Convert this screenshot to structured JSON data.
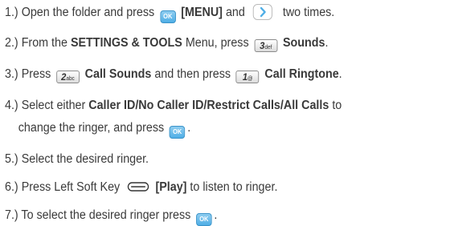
{
  "steps": [
    {
      "num": "1.)",
      "t1": "Open the folder and press",
      "k1": "OK",
      "b1": "[MENU]",
      "t2": "and",
      "t3": "two times."
    },
    {
      "num": "2.)",
      "t1": "From the",
      "b1": "SETTINGS & TOOLS",
      "t2": "Menu, press",
      "k1": "3",
      "k1sub": "def",
      "b2": "Sounds",
      "t3": "."
    },
    {
      "num": "3.)",
      "t1": "Press",
      "k1": "2",
      "k1sub": "abc",
      "b1": "Call Sounds",
      "t2": "and then press",
      "k2": "1",
      "k2sub": "@",
      "b2": "Call Ringtone",
      "t3": "."
    },
    {
      "num": "4.)",
      "t1": "Select either",
      "b1": "Caller ID/No Caller ID/Restrict Calls/All Calls",
      "t2": "to",
      "t3": "change the ringer, and press",
      "k1": "OK",
      "t4": "."
    },
    {
      "num": "5.)",
      "t1": "Select the desired ringer."
    },
    {
      "num": "6.)",
      "t1": "Press Left Soft Key",
      "b1": "[Play]",
      "t2": "to listen to ringer."
    },
    {
      "num": "7.)",
      "t1": "To select the desired ringer press",
      "k1": "OK",
      "t2": "."
    }
  ],
  "icons": {
    "ok_key": "ok-key-icon",
    "nav_key": "nav-right-key-icon",
    "number_key": "number-key-icon",
    "soft_key": "left-soft-key-icon"
  },
  "colors": {
    "text": "#3a3a3a",
    "ok_key": "#4faee6",
    "nav_arrow": "#4faee6"
  }
}
